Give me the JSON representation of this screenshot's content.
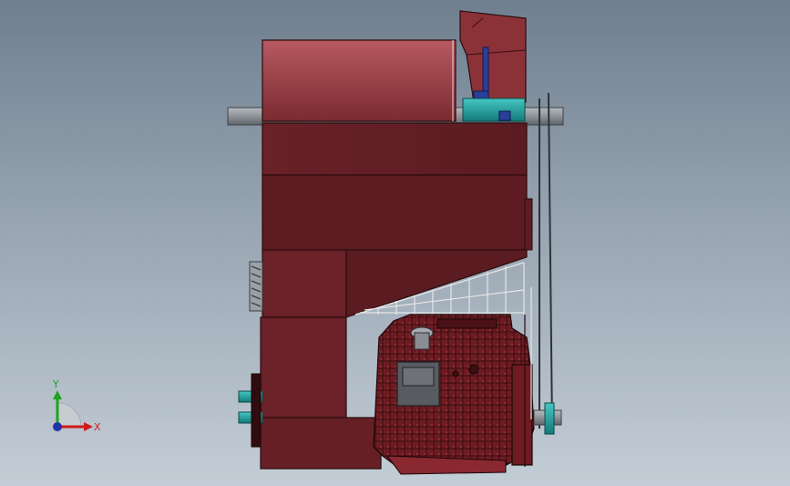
{
  "window": {
    "title": ""
  },
  "scene": {
    "background": {
      "top": "#6f7f8f",
      "bottom": "#c3cdd6"
    },
    "colors": {
      "body_shell": "#7a2a30",
      "body_shell_light": "#a84e55",
      "body_shell_dark": "#4f1a1f",
      "shaft": "#8e9398",
      "teal_part": "#1f9e9b",
      "blue_bracket": "#2a3f9a",
      "engine": "#7b2228",
      "engine_dark": "#3a0f12",
      "wire_frame": "#e6e6e6"
    }
  },
  "triad": {
    "x_label": "X",
    "y_label": "Y",
    "x_color": "#d01b1b",
    "y_color": "#1aa51a",
    "origin_color": "#2233aa"
  }
}
